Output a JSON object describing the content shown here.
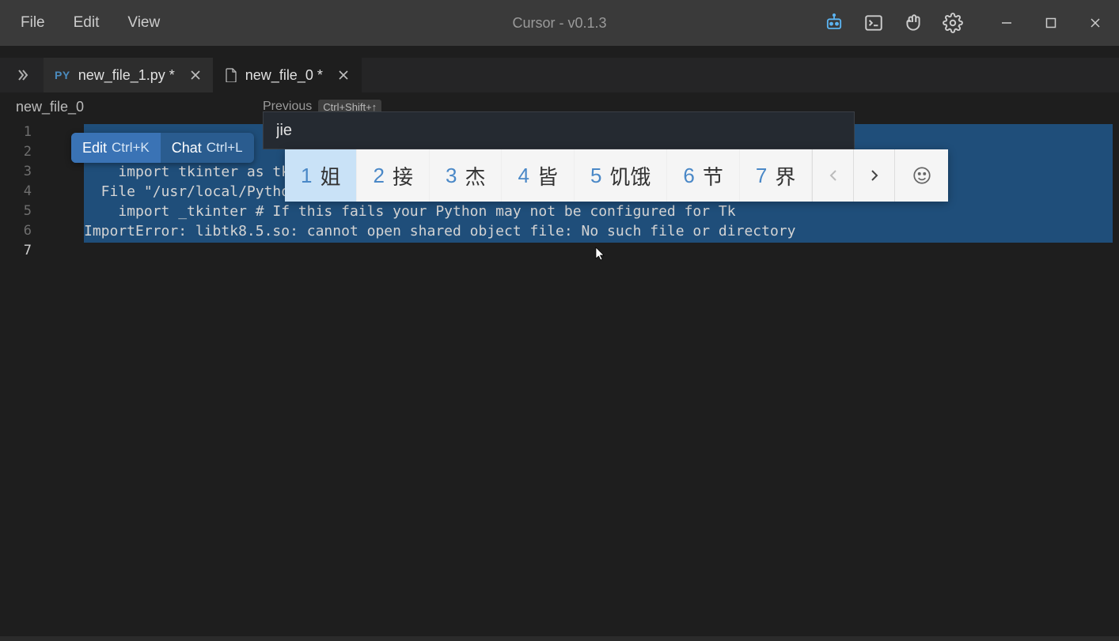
{
  "menu": {
    "file": "File",
    "edit": "Edit",
    "view": "View"
  },
  "app_title": "Cursor - v0.1.3",
  "tabs": [
    {
      "icon": "PY",
      "label": "new_file_1.py *"
    },
    {
      "icon": "file",
      "label": "new_file_0 *"
    }
  ],
  "breadcrumb": "new_file_0",
  "prev_hint": {
    "label": "Previous",
    "shortcut": "Ctrl+Shift+↑"
  },
  "inline_actions": {
    "edit": {
      "label": "Edit",
      "kbd": "Ctrl+K"
    },
    "chat": {
      "label": "Chat",
      "kbd": "Ctrl+L"
    }
  },
  "find_input": "jie",
  "ime": {
    "candidates": [
      {
        "n": "1",
        "ch": "姐"
      },
      {
        "n": "2",
        "ch": "接"
      },
      {
        "n": "3",
        "ch": "杰"
      },
      {
        "n": "4",
        "ch": "皆"
      },
      {
        "n": "5",
        "ch": "饥饿"
      },
      {
        "n": "6",
        "ch": "节"
      },
      {
        "n": "7",
        "ch": "界"
      }
    ]
  },
  "code_lines": [
    "",
    "",
    "    import tkinter as tk",
    "  File \"/usr/local/Pytho",
    "    import _tkinter # If this fails your Python may not be configured for Tk",
    "ImportError: libtk8.5.so: cannot open shared object file: No such file or directory",
    ""
  ],
  "line_numbers": [
    "1",
    "2",
    "3",
    "4",
    "5",
    "6",
    "7"
  ]
}
